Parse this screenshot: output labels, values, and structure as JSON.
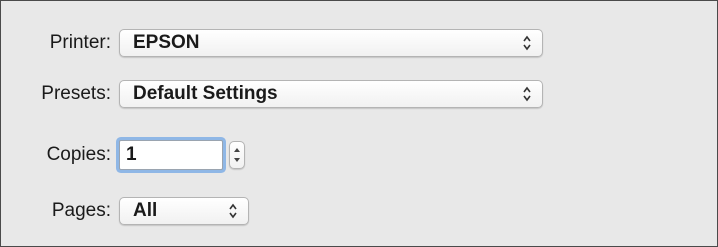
{
  "print_dialog": {
    "printer": {
      "label": "Printer:",
      "value": "EPSON"
    },
    "presets": {
      "label": "Presets:",
      "value": "Default Settings"
    },
    "copies": {
      "label": "Copies:",
      "value": "1"
    },
    "pages": {
      "label": "Pages:",
      "value": "All"
    }
  },
  "icons": {
    "popup_arrows": "updown-chevron-icon",
    "stepper": "stepper-arrows-icon"
  },
  "colors": {
    "background": "#e8e8e8",
    "focus_ring": "#8fb7e6",
    "border": "#4a4a4a"
  }
}
